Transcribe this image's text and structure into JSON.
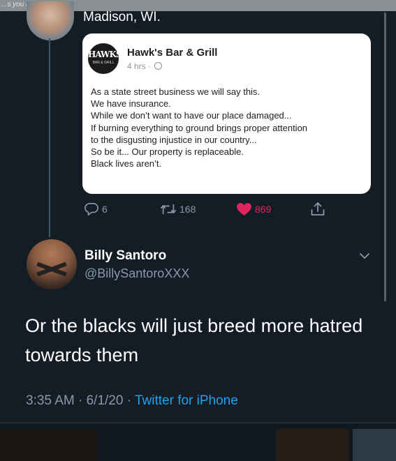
{
  "top_strip": {
    "partial_text": "...s you ro..."
  },
  "quoted_tweet": {
    "location_line": "Madison, WI."
  },
  "fb_post": {
    "page_name": "Hawk's Bar & Grill",
    "logo_text": "HAWKS",
    "logo_subtext": "BAR & GRILL",
    "time": "4 hrs ·",
    "body_lines": [
      "As a state street business we will say this.",
      "We have insurance.",
      "While we don’t want to have our place damaged...",
      "If burning everything to ground brings proper attention",
      "to the disgusting injustice in our country...",
      "So be it... Our property is replaceable.",
      "Black lives aren’t."
    ]
  },
  "actions": {
    "reply_count": "6",
    "retweet_count": "168",
    "like_count": "869",
    "like_color": "#e0245e",
    "icons": [
      "reply-icon",
      "retweet-icon",
      "heart-icon",
      "share-icon"
    ]
  },
  "reply": {
    "display_name": "Billy Santoro",
    "handle": "@BillySantoroXXX",
    "text": "Or the blacks will just breed more hatred towards them",
    "timestamp": "3:35 AM · 6/1/20 · ",
    "source": "Twitter for iPhone",
    "source_color": "#1da1f2"
  },
  "theme": {
    "background": "#141d26",
    "muted_text": "#8899a6"
  }
}
